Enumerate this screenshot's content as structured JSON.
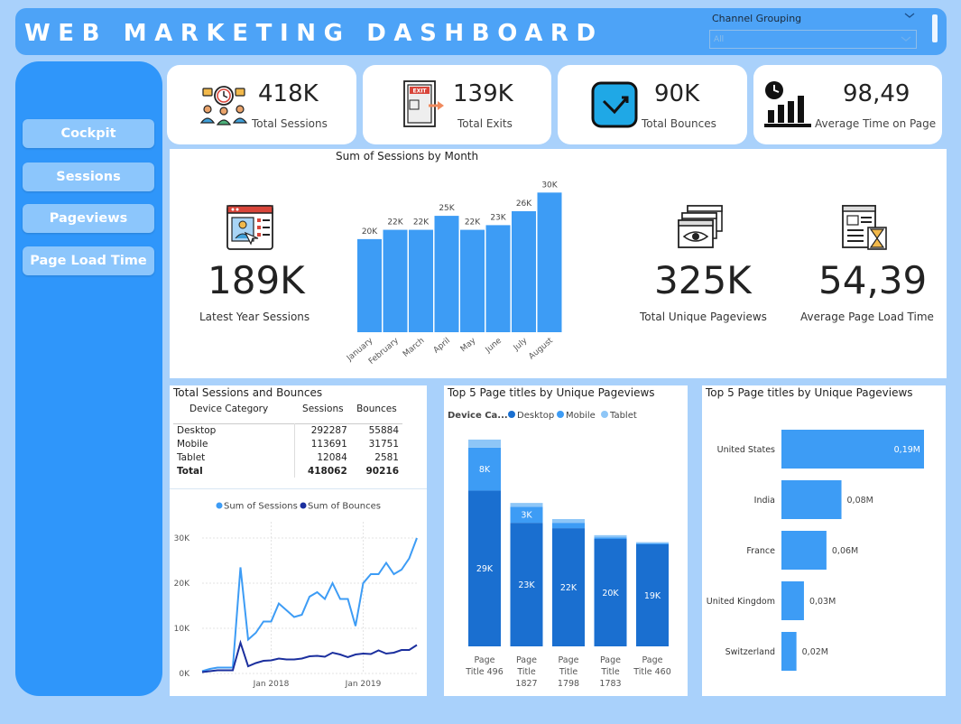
{
  "header": {
    "title": "WEB MARKETING DASHBOARD",
    "slicer_label": "Channel Grouping",
    "slicer_value": "All"
  },
  "nav": [
    "Cockpit",
    "Sessions",
    "Pageviews",
    "Page Load Time"
  ],
  "kpis": [
    {
      "value": "418K",
      "label": "Total Sessions",
      "icon": "people-clock-icon"
    },
    {
      "value": "139K",
      "label": "Total Exits",
      "icon": "exit-door-icon"
    },
    {
      "value": "90K",
      "label": "Total Bounces",
      "icon": "bounce-arrow-icon"
    },
    {
      "value": "98,49",
      "label": "Average Time on Page",
      "icon": "time-chart-icon"
    }
  ],
  "latest_year": {
    "value": "189K",
    "label": "Latest Year Sessions",
    "icon": "web-analytics-icon"
  },
  "unique_pageviews": {
    "value": "325K",
    "label": "Total Unique Pageviews",
    "icon": "windows-eye-icon"
  },
  "page_load": {
    "value": "54,39",
    "label": "Average Page Load Time",
    "icon": "page-hourglass-icon"
  },
  "sessions_table": {
    "title": "Total Sessions and Bounces",
    "headers": [
      "Device Category",
      "Sessions",
      "Bounces"
    ],
    "rows": [
      [
        "Desktop",
        "292287",
        "55884"
      ],
      [
        "Mobile",
        "113691",
        "31751"
      ],
      [
        "Tablet",
        "12084",
        "2581"
      ]
    ],
    "total": [
      "Total",
      "418062",
      "90216"
    ]
  },
  "colors": {
    "primary": "#3d9cf5",
    "dark_blue": "#1a6fd0",
    "navy": "#1b2f9e",
    "light": "#8ec6f7",
    "sidebar": "#2f96fa"
  },
  "chart_data": [
    {
      "type": "bar",
      "title": "Sum of Sessions by Month",
      "categories": [
        "January",
        "February",
        "March",
        "April",
        "May",
        "June",
        "July",
        "August"
      ],
      "values": [
        20,
        22,
        22,
        25,
        22,
        23,
        26,
        30
      ],
      "data_labels": [
        "20K",
        "22K",
        "22K",
        "25K",
        "22K",
        "23K",
        "26K",
        "30K"
      ],
      "unit": "K",
      "ylim": [
        0,
        32
      ]
    },
    {
      "type": "line",
      "legend": [
        "Sum of Sessions",
        "Sum of Bounces"
      ],
      "y_ticks": [
        "30K",
        "20K",
        "10K",
        "0K"
      ],
      "x_ticks": [
        "Jan 2018",
        "Jan 2019"
      ],
      "ylim": [
        0,
        32
      ],
      "x": [
        "2017-04",
        "2017-05",
        "2017-06",
        "2017-07",
        "2017-08",
        "2017-09",
        "2017-10",
        "2017-11",
        "2017-12",
        "2018-01",
        "2018-02",
        "2018-03",
        "2018-04",
        "2018-05",
        "2018-06",
        "2018-07",
        "2018-08",
        "2018-09",
        "2018-10",
        "2018-11",
        "2018-12",
        "2019-01",
        "2019-02",
        "2019-03",
        "2019-04",
        "2019-05",
        "2019-06",
        "2019-07",
        "2019-08"
      ],
      "series": [
        {
          "name": "Sum of Sessions",
          "values": [
            0.5,
            1,
            1.3,
            1.3,
            1.3,
            23.5,
            7.5,
            9,
            11.5,
            11.5,
            15.5,
            14,
            12.5,
            13,
            17,
            18,
            16.5,
            20,
            16.5,
            16.5,
            10.5,
            20,
            22,
            22,
            24.5,
            22,
            23,
            25.5,
            30
          ]
        },
        {
          "name": "Sum of Bounces",
          "values": [
            0.3,
            0.5,
            0.7,
            0.7,
            0.7,
            6.8,
            1.6,
            2.3,
            2.8,
            2.9,
            3.3,
            3.1,
            3.1,
            3.3,
            3.8,
            3.9,
            3.7,
            4.6,
            4.2,
            3.6,
            4.2,
            4.4,
            4.3,
            5.1,
            4.4,
            4.6,
            5.2,
            5.2,
            6.3
          ]
        }
      ]
    },
    {
      "type": "bar",
      "stacked": true,
      "title": "Top 5 Page titles by Unique Pageviews",
      "legend_title": "Device Ca...",
      "categories": [
        "Page Title 496",
        "Page Title 1827",
        "Page Title 1798",
        "Page Title 1783",
        "Page Title 460"
      ],
      "series": [
        {
          "name": "Desktop",
          "values": [
            29,
            23,
            22,
            20,
            19
          ],
          "labels": [
            "29K",
            "23K",
            "22K",
            "20K",
            "19K"
          ]
        },
        {
          "name": "Mobile",
          "values": [
            8,
            3,
            1,
            0.3,
            0.2
          ],
          "labels": [
            "8K",
            "3K",
            "",
            "",
            ""
          ]
        },
        {
          "name": "Tablet",
          "values": [
            1.5,
            0.7,
            0.7,
            0.4,
            0.2
          ],
          "labels": [
            "",
            "",
            "",
            "",
            ""
          ]
        }
      ],
      "ylim": [
        0,
        40
      ]
    },
    {
      "type": "bar",
      "orientation": "horizontal",
      "title": "Top 5 Page titles by Unique Pageviews",
      "categories": [
        "United States",
        "India",
        "France",
        "United Kingdom",
        "Switzerland"
      ],
      "values": [
        0.19,
        0.08,
        0.06,
        0.03,
        0.02
      ],
      "data_labels": [
        "0,19M",
        "0,08M",
        "0,06M",
        "0,03M",
        "0,02M"
      ],
      "xlim": [
        0,
        0.19
      ]
    }
  ]
}
